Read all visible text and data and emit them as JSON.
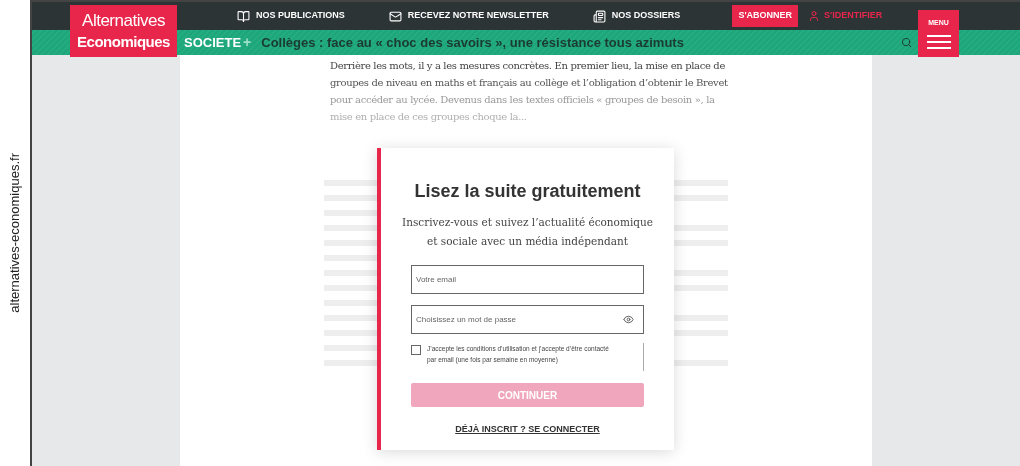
{
  "caption": "alternatives-economiques.fr",
  "logo": {
    "line_1": "Alternatives",
    "line_2": "Economiques"
  },
  "top_nav": [
    {
      "label": "NOS PUBLICATIONS",
      "kind": "book"
    },
    {
      "label": "RECEVEZ NOTRE NEWSLETTER",
      "kind": "mail"
    },
    {
      "label": "NOS DOSSIERS",
      "kind": "folder"
    }
  ],
  "subscribe_button": "S'ABONNER",
  "login_link": "S'IDENTIFIER",
  "menu_button": "MENU",
  "section_bar": {
    "section": "SOCIETE",
    "plus": "+",
    "headline": "Collèges : face au « choc des savoirs », une résistance tous azimuts"
  },
  "article_lines": [
    "Derrière les mots, il y a les mesures concrètes. En premier lieu, la mise en place de",
    "groupes de niveau en maths et français au collège et l’obligation d’obtenir le Brevet",
    "pour accéder au lycée. Devenus dans les textes officiels « groupes de besoin », la",
    "mise en place de ces groupes choque la..."
  ],
  "signup": {
    "title": "Lisez la suite gratuitement",
    "subtitle": "Inscrivez-vous et suivez l’actualité économique et sociale avec un média indépendant",
    "email": {
      "placeholder": "Votre email"
    },
    "password": {
      "placeholder": "Choisissez un mot de passe"
    },
    "consent": {
      "label": "J’accepte les conditions d’utilisation et j’accepte d’être contacté par email (une fois par semaine en moyenne)",
      "checked": false
    },
    "continue_button": {
      "label": "CONTINUER",
      "disabled": true
    },
    "login_link": "DÉJÀ INSCRIT ? SE CONNECTER"
  }
}
